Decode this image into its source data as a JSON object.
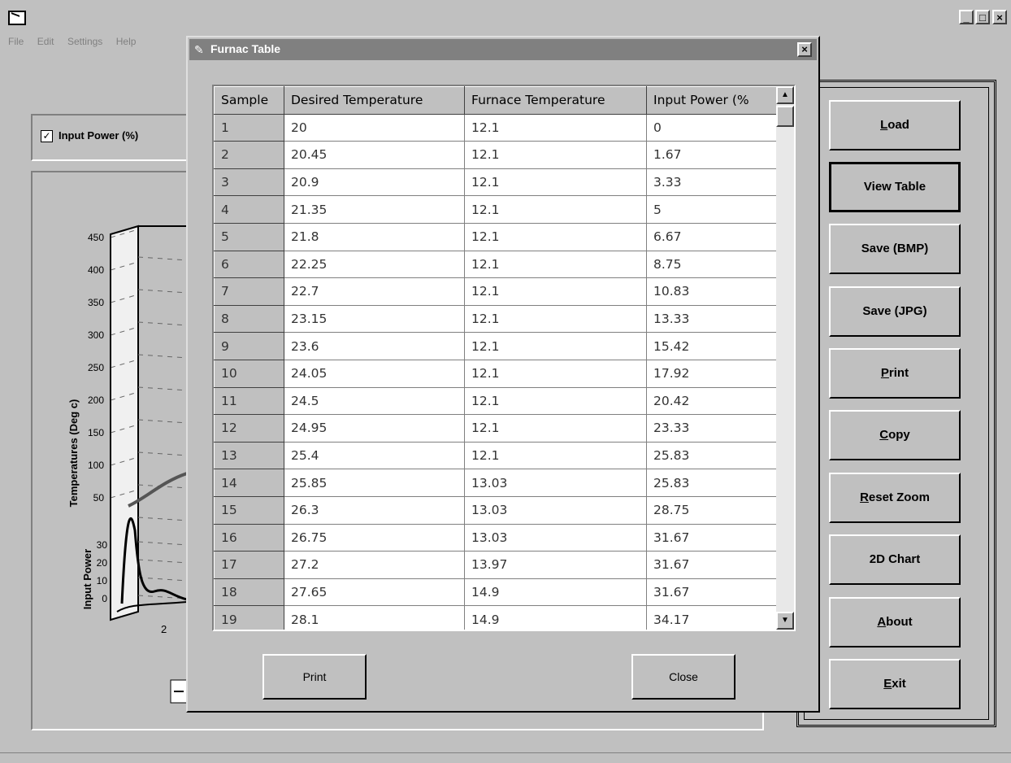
{
  "window": {
    "minimize": "_",
    "maximize": "□",
    "close": "×"
  },
  "menu": [
    "File",
    "Edit",
    "Settings",
    "Help"
  ],
  "chart_panel": {
    "checkbox_label": "Input Power (%)",
    "checkbox_checked": true,
    "ylabel_top": "Temperatures (Deg c)",
    "ylabel_bottom": "Input Power",
    "yticks_top": [
      "450",
      "400",
      "350",
      "300",
      "250",
      "200",
      "150",
      "100",
      "50"
    ],
    "yticks_bottom": [
      "30",
      "20",
      "10",
      "0"
    ],
    "xtick": "2"
  },
  "buttons": [
    "Load",
    "View Table",
    "Save (BMP)",
    "Save (JPG)",
    "Print",
    "Copy",
    "Reset Zoom",
    "2D Chart",
    "About",
    "Exit"
  ],
  "dialog": {
    "title": "Furnac Table",
    "close": "×",
    "columns": [
      "Sample",
      "Desired Temperature",
      "Furnace Temperature",
      "Input Power (%"
    ],
    "rows": [
      [
        "1",
        "20",
        "12.1",
        "0"
      ],
      [
        "2",
        "20.45",
        "12.1",
        "1.67"
      ],
      [
        "3",
        "20.9",
        "12.1",
        "3.33"
      ],
      [
        "4",
        "21.35",
        "12.1",
        "5"
      ],
      [
        "5",
        "21.8",
        "12.1",
        "6.67"
      ],
      [
        "6",
        "22.25",
        "12.1",
        "8.75"
      ],
      [
        "7",
        "22.7",
        "12.1",
        "10.83"
      ],
      [
        "8",
        "23.15",
        "12.1",
        "13.33"
      ],
      [
        "9",
        "23.6",
        "12.1",
        "15.42"
      ],
      [
        "10",
        "24.05",
        "12.1",
        "17.92"
      ],
      [
        "11",
        "24.5",
        "12.1",
        "20.42"
      ],
      [
        "12",
        "24.95",
        "12.1",
        "23.33"
      ],
      [
        "13",
        "25.4",
        "12.1",
        "25.83"
      ],
      [
        "14",
        "25.85",
        "13.03",
        "25.83"
      ],
      [
        "15",
        "26.3",
        "13.03",
        "28.75"
      ],
      [
        "16",
        "26.75",
        "13.03",
        "31.67"
      ],
      [
        "17",
        "27.2",
        "13.97",
        "31.67"
      ],
      [
        "18",
        "27.65",
        "14.9",
        "31.67"
      ],
      [
        "19",
        "28.1",
        "14.9",
        "34.17"
      ]
    ],
    "print_label": "Print",
    "close_label": "Close"
  }
}
